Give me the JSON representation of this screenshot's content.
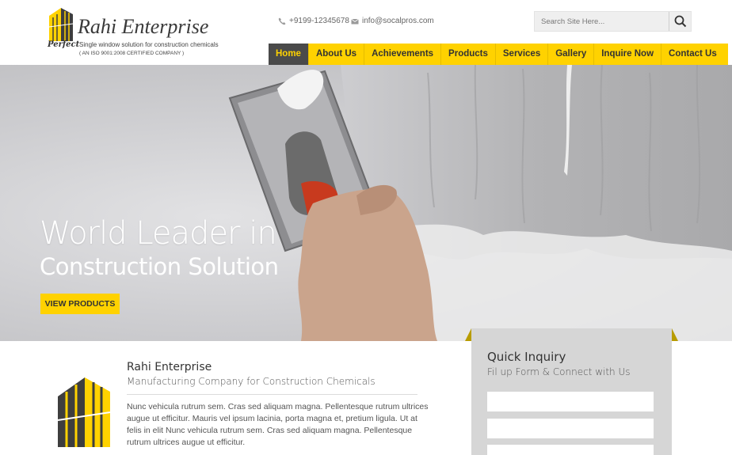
{
  "brand": {
    "name": "Rahi Enterprise",
    "mark_text": "Perfect",
    "tagline": "Single window solution for construction chemicals",
    "certification": "( AN ISO 9001:2008 CERTIFIED COMPANY )"
  },
  "contact": {
    "phone": "+9199-12345678",
    "email": "info@socalpros.com"
  },
  "search": {
    "placeholder": "Search Site Here..."
  },
  "nav": {
    "items": [
      "Home",
      "About Us",
      "Achievements",
      "Products",
      "Services",
      "Gallery",
      "Inquire Now",
      "Contact Us"
    ],
    "active": "Home"
  },
  "hero": {
    "title_line1": "World Leader in",
    "title_line2": "Construction Solution",
    "cta_label": "VIEW PRODUCTS"
  },
  "about": {
    "title": "Rahi Enterprise",
    "subtitle": "Manufacturing Company for Construction Chemicals",
    "text": "Nunc vehicula rutrum sem. Cras sed aliquam magna. Pellentesque rutrum ultrices augue ut efficitur. Mauris vel ipsum lacinia, porta magna et, pretium ligula. Ut at felis in elit Nunc vehicula rutrum sem. Cras sed aliquam magna. Pellentesque rutrum ultrices augue ut efficitur."
  },
  "inquiry": {
    "title": "Quick Inquiry",
    "subtitle": "Fil up Form & Connect with Us"
  },
  "colors": {
    "accent": "#ffd200",
    "nav_active_bg": "#4a4a4a",
    "text_dark": "#333333",
    "panel_grey": "#d6d6d6"
  },
  "icons": {
    "phone": "phone-icon",
    "email": "envelope-icon",
    "search": "search-icon"
  }
}
